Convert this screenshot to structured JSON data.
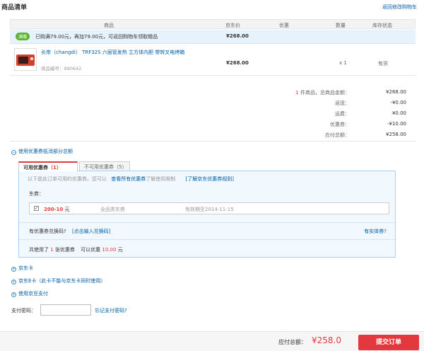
{
  "header": {
    "title": "商品清单",
    "back_link": "返回修改购物车"
  },
  "table": {
    "columns": [
      "商品",
      "京东价",
      "优惠",
      "数量",
      "库存状态"
    ]
  },
  "promo": {
    "tag": "满赠",
    "text": "已购满79.00元，再加79.00元，可返回购物车领取赠品",
    "price": "¥268.00"
  },
  "product": {
    "name": "长帝（changdi） TRF32S 六层管发热 立方体内胆 带转叉电烤箱",
    "id_label": "商品编号：",
    "id": "990642",
    "price": "¥268.00",
    "qty": "x 1",
    "stock": "有货"
  },
  "summary": {
    "rows": [
      {
        "label_prefix": "1",
        "label": " 件商品，总商品金额：",
        "value": "¥268.00"
      },
      {
        "label_prefix": "",
        "label": "返现：",
        "value": "-¥0.00"
      },
      {
        "label_prefix": "",
        "label": "运费：",
        "value": "¥0.00"
      },
      {
        "label_prefix": "",
        "label": "优惠券：",
        "value": "-¥10.00"
      },
      {
        "label_prefix": "",
        "label": "应付总额：",
        "value": "¥258.00"
      }
    ]
  },
  "coupon_section": {
    "toggle": "使用优惠券抵消部分总额",
    "tab_usable": "可用优惠券",
    "tab_usable_count": "1",
    "tab_unusable": "不可用优惠券",
    "tab_unusable_count": "5",
    "note": "以下是此订单可用的优惠券。您可以",
    "view_all": "查看所有优惠券",
    "note_tail": "了解使用限制",
    "learn_more": "[了解京东优惠券规则]",
    "coupon_label": "东券：",
    "coupon": {
      "amount": "200-10",
      "unit": "元",
      "scope": "全品类东券",
      "expiry": "有效期至2014-11-15"
    },
    "code_label": "有优惠券兑换码?",
    "code_link": "[点击输入兑换码]",
    "physical": "有实体券?",
    "used_prefix": "共使用了",
    "used_count": "1",
    "used_mid": "张优惠券",
    "save_prefix": "可以优惠",
    "save_amount": "10.00",
    "save_unit": "元"
  },
  "other_payments": [
    "京东卡",
    "京东E卡（此卡不能与京东卡同时使用）",
    "使用京豆支付"
  ],
  "pay_password": {
    "label": "支付密码：",
    "value": "",
    "forgot": "忘记支付密码?"
  },
  "footer": {
    "total_label": "应付总额：",
    "total_value": "¥258.0",
    "submit": "提交订单"
  }
}
